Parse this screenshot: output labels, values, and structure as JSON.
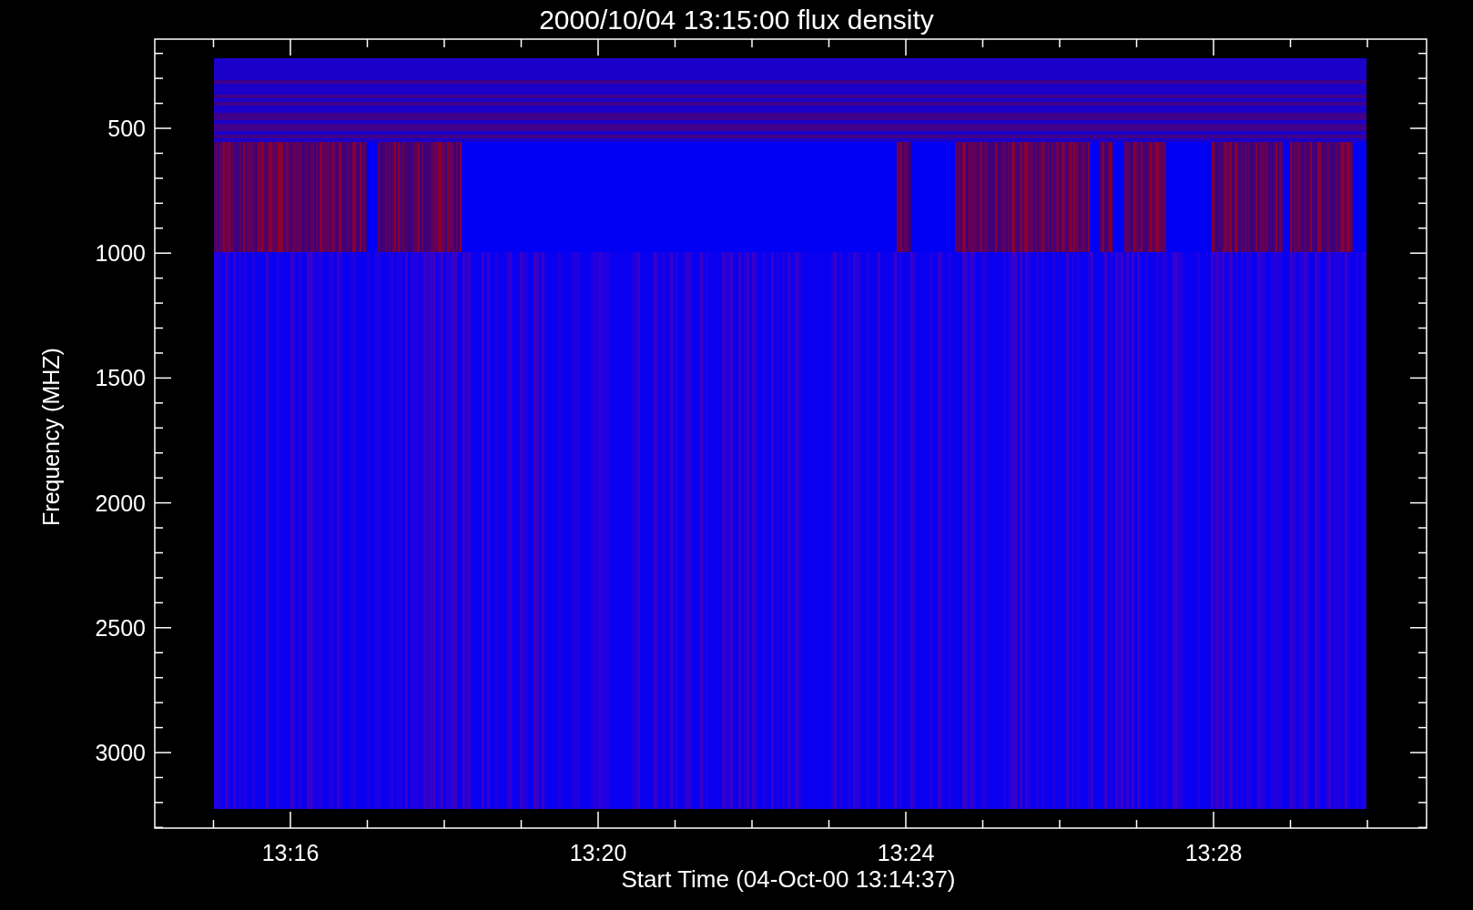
{
  "plot": {
    "title": "2000/10/04 13:15:00 flux density",
    "y_axis": {
      "label": "Frequency (MHZ)",
      "ticks": [
        "500",
        "1000",
        "1500",
        "2000",
        "2500",
        "3000"
      ]
    },
    "x_axis": {
      "label": "Start Time (04-Oct-00 13:14:37)",
      "ticks": [
        "13:16",
        "13:20",
        "13:24",
        "13:28"
      ]
    }
  }
}
